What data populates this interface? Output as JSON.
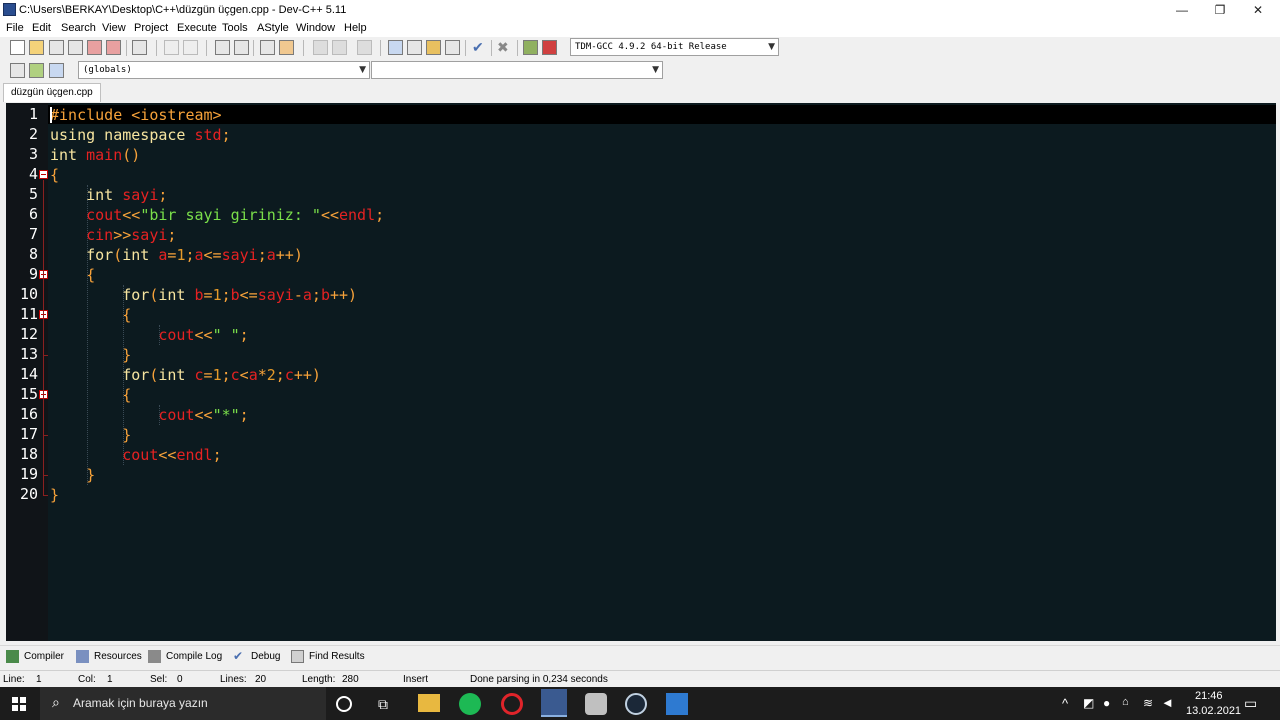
{
  "window": {
    "title": "C:\\Users\\BERKAY\\Desktop\\C++\\düzgün üçgen.cpp - Dev-C++ 5.11",
    "minimize_glyph": "—",
    "maximize_glyph": "❐",
    "close_glyph": "✕"
  },
  "menu": [
    "File",
    "Edit",
    "Search",
    "View",
    "Project",
    "Execute",
    "Tools",
    "AStyle",
    "Window",
    "Help"
  ],
  "toolbar": {
    "compiler_select": "TDM-GCC 4.9.2 64-bit Release",
    "globals_select": "(globals)",
    "member_select": ""
  },
  "tabs": [
    {
      "label": "düzgün üçgen.cpp",
      "active": true
    }
  ],
  "editor": {
    "line_numbers": [
      "1",
      "2",
      "3",
      "4",
      "5",
      "6",
      "7",
      "8",
      "9",
      "10",
      "11",
      "12",
      "13",
      "14",
      "15",
      "16",
      "17",
      "18",
      "19",
      "20"
    ],
    "lines": [
      [
        {
          "t": "#include <iostream>",
          "c": "inc"
        }
      ],
      [
        {
          "t": "using namespace ",
          "c": "kw"
        },
        {
          "t": "std",
          "c": "red"
        },
        {
          "t": ";",
          "c": "sym"
        }
      ],
      [
        {
          "t": "int ",
          "c": "kw"
        },
        {
          "t": "main",
          "c": "red"
        },
        {
          "t": "()",
          "c": "sym"
        }
      ],
      [
        {
          "t": "{",
          "c": "sym"
        }
      ],
      [
        {
          "t": "    int ",
          "c": "kw"
        },
        {
          "t": "sayi",
          "c": "red"
        },
        {
          "t": ";",
          "c": "sym"
        }
      ],
      [
        {
          "t": "    cout",
          "c": "red"
        },
        {
          "t": "<<",
          "c": "sym"
        },
        {
          "t": "\"bir sayi giriniz: \"",
          "c": "str"
        },
        {
          "t": "<<",
          "c": "sym"
        },
        {
          "t": "endl",
          "c": "red"
        },
        {
          "t": ";",
          "c": "sym"
        }
      ],
      [
        {
          "t": "    cin",
          "c": "red"
        },
        {
          "t": ">>",
          "c": "sym"
        },
        {
          "t": "sayi",
          "c": "red"
        },
        {
          "t": ";",
          "c": "sym"
        }
      ],
      [
        {
          "t": "    for",
          "c": "kw"
        },
        {
          "t": "(",
          "c": "sym"
        },
        {
          "t": "int ",
          "c": "kw"
        },
        {
          "t": "a",
          "c": "red"
        },
        {
          "t": "=",
          "c": "sym"
        },
        {
          "t": "1",
          "c": "num"
        },
        {
          "t": ";",
          "c": "sym"
        },
        {
          "t": "a",
          "c": "red"
        },
        {
          "t": "<=",
          "c": "sym"
        },
        {
          "t": "sayi",
          "c": "red"
        },
        {
          "t": ";",
          "c": "sym"
        },
        {
          "t": "a",
          "c": "red"
        },
        {
          "t": "++)",
          "c": "sym"
        }
      ],
      [
        {
          "t": "    {",
          "c": "sym"
        }
      ],
      [
        {
          "t": "        for",
          "c": "kw"
        },
        {
          "t": "(",
          "c": "sym"
        },
        {
          "t": "int ",
          "c": "kw"
        },
        {
          "t": "b",
          "c": "red"
        },
        {
          "t": "=",
          "c": "sym"
        },
        {
          "t": "1",
          "c": "num"
        },
        {
          "t": ";",
          "c": "sym"
        },
        {
          "t": "b",
          "c": "red"
        },
        {
          "t": "<=",
          "c": "sym"
        },
        {
          "t": "sayi",
          "c": "red"
        },
        {
          "t": "-",
          "c": "sym"
        },
        {
          "t": "a",
          "c": "red"
        },
        {
          "t": ";",
          "c": "sym"
        },
        {
          "t": "b",
          "c": "red"
        },
        {
          "t": "++)",
          "c": "sym"
        }
      ],
      [
        {
          "t": "        {",
          "c": "sym"
        }
      ],
      [
        {
          "t": "            cout",
          "c": "red"
        },
        {
          "t": "<<",
          "c": "sym"
        },
        {
          "t": "\" \"",
          "c": "str"
        },
        {
          "t": ";",
          "c": "sym"
        }
      ],
      [
        {
          "t": "        }",
          "c": "sym"
        }
      ],
      [
        {
          "t": "        for",
          "c": "kw"
        },
        {
          "t": "(",
          "c": "sym"
        },
        {
          "t": "int ",
          "c": "kw"
        },
        {
          "t": "c",
          "c": "red"
        },
        {
          "t": "=",
          "c": "sym"
        },
        {
          "t": "1",
          "c": "num"
        },
        {
          "t": ";",
          "c": "sym"
        },
        {
          "t": "c",
          "c": "red"
        },
        {
          "t": "<",
          "c": "sym"
        },
        {
          "t": "a",
          "c": "red"
        },
        {
          "t": "*",
          "c": "sym"
        },
        {
          "t": "2",
          "c": "num"
        },
        {
          "t": ";",
          "c": "sym"
        },
        {
          "t": "c",
          "c": "red"
        },
        {
          "t": "++)",
          "c": "sym"
        }
      ],
      [
        {
          "t": "        {",
          "c": "sym"
        }
      ],
      [
        {
          "t": "            cout",
          "c": "red"
        },
        {
          "t": "<<",
          "c": "sym"
        },
        {
          "t": "\"*\"",
          "c": "str"
        },
        {
          "t": ";",
          "c": "sym"
        }
      ],
      [
        {
          "t": "        }",
          "c": "sym"
        }
      ],
      [
        {
          "t": "        cout",
          "c": "red"
        },
        {
          "t": "<<",
          "c": "sym"
        },
        {
          "t": "endl",
          "c": "red"
        },
        {
          "t": ";",
          "c": "sym"
        }
      ],
      [
        {
          "t": "    }",
          "c": "sym"
        }
      ],
      [
        {
          "t": "}",
          "c": "sym"
        }
      ]
    ],
    "fold_markers": [
      "4",
      "9",
      "11",
      "15"
    ]
  },
  "bottom_tabs": [
    "Compiler",
    "Resources",
    "Compile Log",
    "Debug",
    "Find Results"
  ],
  "status": {
    "line_label": "Line:",
    "line": "1",
    "col_label": "Col:",
    "col": "1",
    "sel_label": "Sel:",
    "sel": "0",
    "lines_label": "Lines:",
    "lines": "20",
    "length_label": "Length:",
    "length": "280",
    "mode": "Insert",
    "message": "Done parsing in 0,234 seconds"
  },
  "taskbar": {
    "search_placeholder": "Aramak için buraya yazın",
    "time": "21:46",
    "date": "13.02.2021"
  },
  "colors": {
    "editor_bg": "#0c1a1f",
    "gutter_bg": "#101418",
    "keyword": "#f7e5a0",
    "identifier": "#e52222",
    "string": "#7adf4a",
    "symbol": "#f7a23a"
  }
}
